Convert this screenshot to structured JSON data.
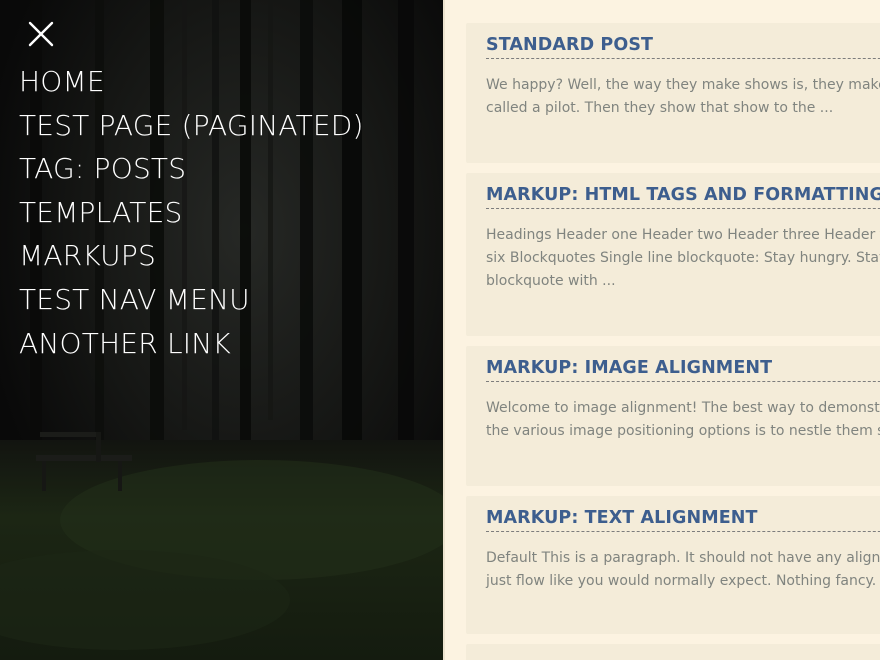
{
  "menu": {
    "close_label": "Close menu",
    "items": [
      {
        "label": "HOME"
      },
      {
        "label": "TEST PAGE (PAGINATED)"
      },
      {
        "label": "TAG: POSTS"
      },
      {
        "label": "TEMPLATES"
      },
      {
        "label": "MARKUPS"
      },
      {
        "label": "TEST NAV MENU"
      },
      {
        "label": "ANOTHER LINK"
      }
    ]
  },
  "posts": [
    {
      "title": "STANDARD POST",
      "excerpt_lines": [
        "We happy? Well, the way they make shows is, they make",
        "called a pilot. Then they show that show to the ..."
      ]
    },
    {
      "title": "MARKUP: HTML TAGS AND FORMATTING",
      "excerpt_lines": [
        "Headings Header one Header two Header three Header f",
        "six Blockquotes Single line blockquote: Stay hungry. Stay",
        "blockquote with ..."
      ]
    },
    {
      "title": "MARKUP: IMAGE ALIGNMENT",
      "excerpt_lines": [
        "Welcome to image alignment! The best way to demonstr",
        "the various image positioning options is to nestle them s"
      ]
    },
    {
      "title": "MARKUP: TEXT ALIGNMENT",
      "excerpt_lines": [
        "Default This is a paragraph. It should not have any align",
        "just flow like you would normally expect. Nothing fancy."
      ]
    }
  ],
  "colors": {
    "menu_text": "#ffffff",
    "post_title": "#3d5e8e",
    "excerpt": "#80847f",
    "card": "#f4ecd9",
    "page": "#fcf3e1"
  },
  "icons": {
    "close": "close-icon"
  }
}
